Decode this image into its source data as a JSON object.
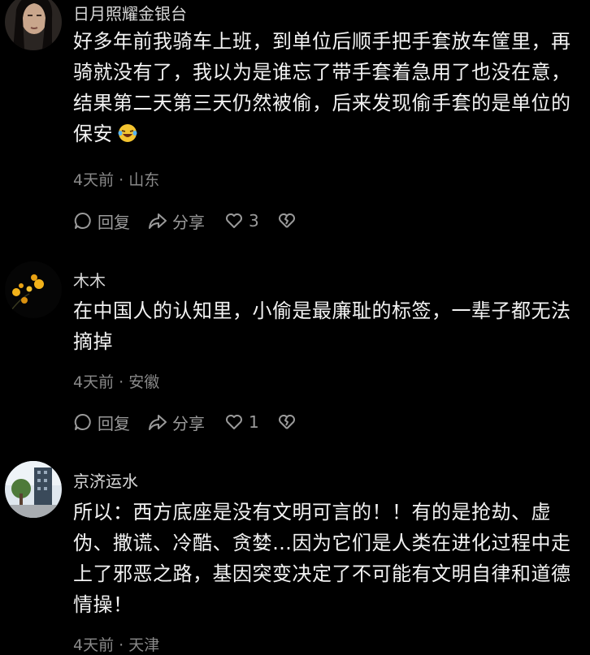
{
  "comments": [
    {
      "username": "日月照耀金银台",
      "lines": [
        "好多年前我骑车上班，到单位后顺手把手套放车筐里，再",
        "骑就没有了，我以为是谁忘了带手套着急用了也没在意，",
        "结果第二天第三天仍然被偷，后来发现偷手套的是单位的",
        "保安"
      ],
      "emoji": "laughing-crying-emoji",
      "meta": "4天前 · 山东",
      "reply_label": "回复",
      "share_label": "分享",
      "like_count": "3"
    },
    {
      "username": "木木",
      "lines": [
        "在中国人的认知里，小偷是最廉耻的标签，一辈子都无法",
        "摘掉"
      ],
      "meta": "4天前 · 安徽",
      "reply_label": "回复",
      "share_label": "分享",
      "like_count": "1"
    },
    {
      "username": "京济运水",
      "lines": [
        "所以：西方底座是没有文明可言的！！有的是抢劫、虚",
        "伪、撒谎、冷酷、贪婪…因为它们是人类在进化过程中走",
        "上了邪恶之路，基因突变决定了不可能有文明自律和道德",
        "情操！"
      ],
      "meta": "4天前 · 天津"
    }
  ],
  "colors": {
    "background": "#000000",
    "text": "#f2f2f2",
    "secondary": "#8a8a8a",
    "icon": "#9a9a9a"
  }
}
